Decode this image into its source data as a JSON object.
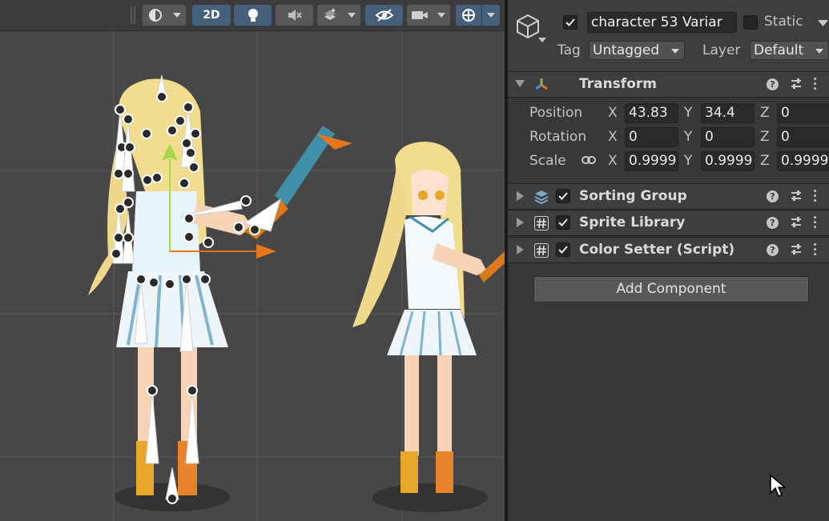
{
  "scene_toolbar": {
    "toggle_2d_label": "2D",
    "icons": [
      "draw-mode-icon",
      "lighting-icon",
      "audio-mute-icon",
      "effects-icon",
      "visibility-icon",
      "camera-icon",
      "gizmos-icon"
    ]
  },
  "inspector": {
    "object_name": "character 53 Variar",
    "static_label": "Static",
    "tag_label": "Tag",
    "tag_value": "Untagged",
    "layer_label": "Layer",
    "layer_value": "Default",
    "transform": {
      "title": "Transform",
      "position_label": "Position",
      "rotation_label": "Rotation",
      "scale_label": "Scale",
      "x_label": "X",
      "y_label": "Y",
      "z_label": "Z",
      "position": {
        "x": "43.83",
        "y": "34.4",
        "z": "0"
      },
      "rotation": {
        "x": "0",
        "y": "0",
        "z": "0"
      },
      "scale": {
        "x": "0.9999",
        "y": "0.9999",
        "z": "0.9999"
      }
    },
    "components": [
      {
        "title": "Sorting Group",
        "enabled": true
      },
      {
        "title": "Sprite Library",
        "enabled": true
      },
      {
        "title": "Color Setter (Script)",
        "enabled": true
      }
    ],
    "add_component_label": "Add Component",
    "help_glyph": "?"
  },
  "colors": {
    "accent_toggle": "#46607c",
    "panel_bg": "#383838",
    "scene_bg": "#474747",
    "field_bg": "#2a2a2a"
  }
}
